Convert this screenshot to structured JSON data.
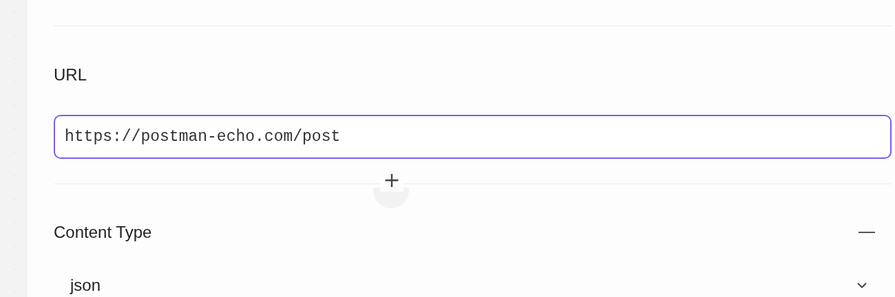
{
  "url_field": {
    "label": "URL",
    "value": "https://postman-echo.com/post",
    "focused": true
  },
  "add_button": {
    "label": "+"
  },
  "content_type": {
    "label": "Content Type",
    "expanded": true,
    "value": "json"
  }
}
